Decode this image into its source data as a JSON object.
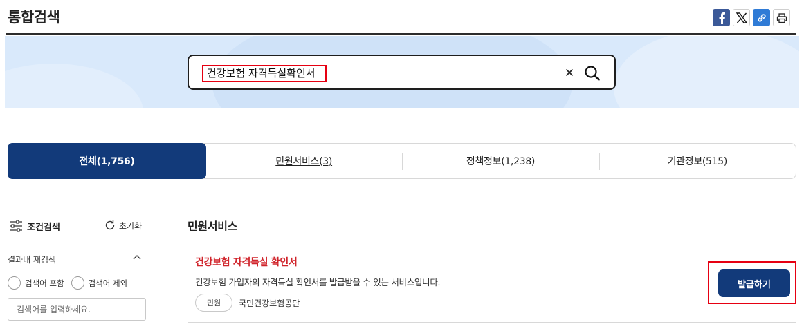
{
  "header": {
    "title": "통합검색"
  },
  "share": [
    {
      "name": "facebook-icon",
      "color": "#3b5998"
    },
    {
      "name": "x-icon",
      "color": "#000000"
    },
    {
      "name": "link-icon",
      "color": "#2f7bd6"
    },
    {
      "name": "print-icon",
      "color": "#333333"
    }
  ],
  "search": {
    "value": "건강보험 자격득실확인서"
  },
  "tabs": [
    {
      "label": "전체(1,756)",
      "active": true
    },
    {
      "label": "민원서비스(3)"
    },
    {
      "label": "정책정보(1,238)"
    },
    {
      "label": "기관정보(515)"
    }
  ],
  "filter": {
    "title": "조건검색",
    "reset_label": "초기화",
    "subsection": "결과내 재검색",
    "radio_include": "검색어 포함",
    "radio_exclude": "검색어 제외",
    "placeholder": "검색어를 입력하세요."
  },
  "section": {
    "title": "민원서비스"
  },
  "result": {
    "title": "건강보험 자격득실 확인서",
    "description": "건강보험 가입자의 자격득실 확인서를 발급받을 수 있는 서비스입니다.",
    "tag": "민원",
    "organization": "국민건강보험공단",
    "button_label": "발급하기"
  },
  "colors": {
    "primary": "#123a7a",
    "highlight": "#e60012",
    "result_title": "#d0242b",
    "hero_bg": "#d9e9fb"
  }
}
